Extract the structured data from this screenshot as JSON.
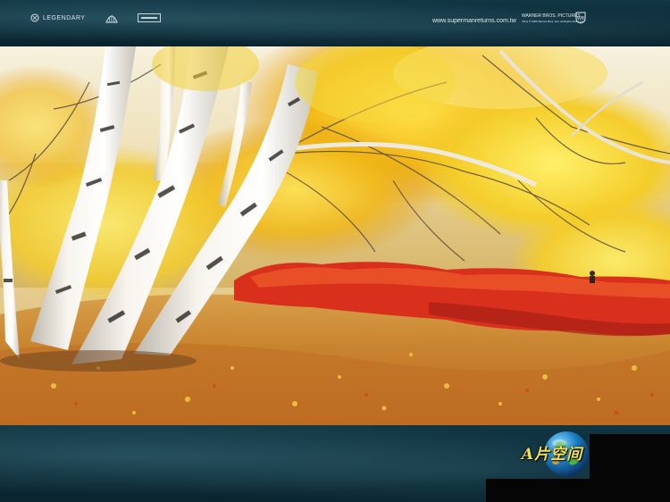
{
  "header": {
    "logo_left": "LEGENDARY",
    "url": "www.supermanreturns.com.tw",
    "studio_logo_lines": [
      "WARNER BROS. PICTURES",
      "TM & © 2006 Warner Bros. Ent. All Rights Reserved"
    ]
  },
  "photo": {
    "subject": "",
    "palette": {
      "sky": "#f3ead0",
      "foliage_yellow": "#f2c218",
      "foliage_orange": "#e59a1e",
      "shrubs_red": "#d8301d",
      "leaf_ground": "#c47a2c",
      "birch_bark": "#eeeae2"
    }
  },
  "watermark": {
    "text": "A片空间",
    "color": "#f4e24a",
    "icon": "globe-icon"
  },
  "colors": {
    "banner": "#0e2f3c"
  }
}
